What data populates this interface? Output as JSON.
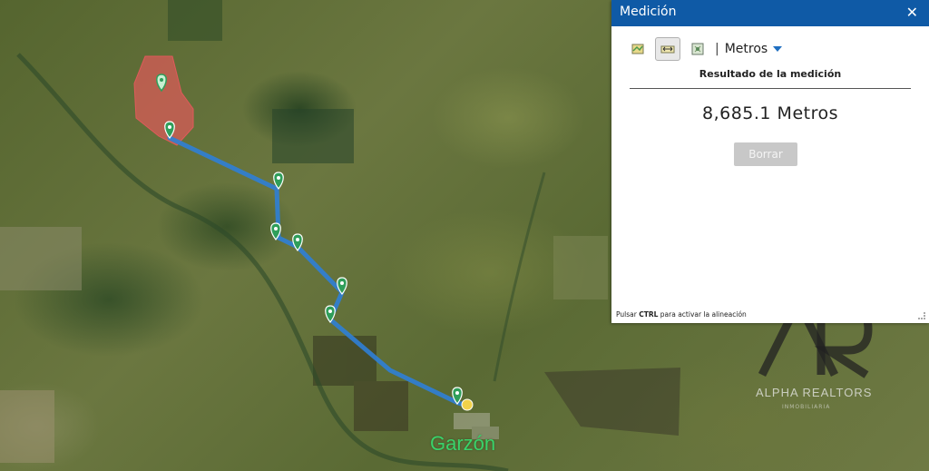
{
  "panel": {
    "title": "Medición",
    "close_glyph": "✕",
    "separator": "|",
    "unit": "Metros",
    "result_heading": "Resultado de la medición",
    "result_value": "8,685.1 Metros",
    "clear_label": "Borrar",
    "hint_prefix": "Pulsar ",
    "hint_key": "CTRL",
    "hint_suffix": " para activar la alineación",
    "tools": [
      "area-measure-icon",
      "distance-measure-icon",
      "location-measure-icon"
    ]
  },
  "map": {
    "town_label": "Garzón",
    "route_color": "#2f7fd6",
    "parcel_color": "#e05a5a",
    "pin_color": "#2f9e5a",
    "end_point_color": "#f2d24a",
    "route_points": 8
  },
  "watermark": {
    "brand": "ALPHA REALTORS",
    "sub": "INMOBILIARIA"
  }
}
